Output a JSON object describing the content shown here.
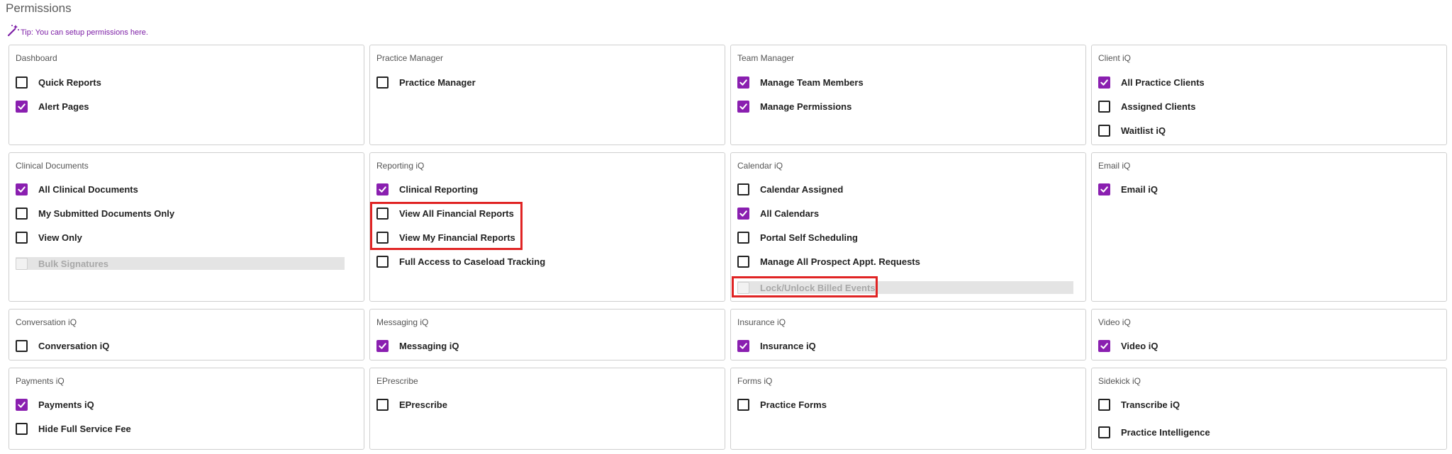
{
  "page": {
    "title": "Permissions",
    "tip": "Tip: You can setup permissions here."
  },
  "colors": {
    "accent": "#8a1fb0",
    "highlight": "#e02424",
    "disabled_bg": "#e4e4e4"
  },
  "cards": {
    "dashboard": {
      "title": "Dashboard",
      "items": [
        {
          "label": "Quick Reports",
          "checked": false
        },
        {
          "label": "Alert Pages",
          "checked": true
        }
      ]
    },
    "practice_manager": {
      "title": "Practice Manager",
      "items": [
        {
          "label": "Practice Manager",
          "checked": false
        }
      ]
    },
    "team_manager": {
      "title": "Team Manager",
      "items": [
        {
          "label": "Manage Team Members",
          "checked": true
        },
        {
          "label": "Manage Permissions",
          "checked": true
        }
      ]
    },
    "client_iq": {
      "title": "Client iQ",
      "items": [
        {
          "label": "All Practice Clients",
          "checked": true
        },
        {
          "label": "Assigned Clients",
          "checked": false
        },
        {
          "label": "Waitlist iQ",
          "checked": false
        }
      ]
    },
    "clinical_documents": {
      "title": "Clinical Documents",
      "items": [
        {
          "label": "All Clinical Documents",
          "checked": true
        },
        {
          "label": "My Submitted Documents Only",
          "checked": false
        },
        {
          "label": "View Only",
          "checked": false
        },
        {
          "label": "Bulk Signatures",
          "checked": false,
          "disabled": true
        }
      ]
    },
    "reporting_iq": {
      "title": "Reporting iQ",
      "items": [
        {
          "label": "Clinical Reporting",
          "checked": true
        },
        {
          "label": "View All Financial Reports",
          "checked": false
        },
        {
          "label": "View My Financial Reports",
          "checked": false
        },
        {
          "label": "Full Access to Caseload Tracking",
          "checked": false
        }
      ]
    },
    "calendar_iq": {
      "title": "Calendar iQ",
      "items": [
        {
          "label": "Calendar Assigned",
          "checked": false
        },
        {
          "label": "All Calendars",
          "checked": true
        },
        {
          "label": "Portal Self Scheduling",
          "checked": false
        },
        {
          "label": "Manage All Prospect Appt. Requests",
          "checked": false
        },
        {
          "label": "Lock/Unlock Billed Events",
          "checked": false,
          "disabled": true
        }
      ]
    },
    "email_iq": {
      "title": "Email iQ",
      "items": [
        {
          "label": "Email iQ",
          "checked": true
        }
      ]
    },
    "conversation_iq": {
      "title": "Conversation iQ",
      "items": [
        {
          "label": "Conversation iQ",
          "checked": false
        }
      ]
    },
    "messaging_iq": {
      "title": "Messaging iQ",
      "items": [
        {
          "label": "Messaging iQ",
          "checked": true
        }
      ]
    },
    "insurance_iq": {
      "title": "Insurance iQ",
      "items": [
        {
          "label": "Insurance iQ",
          "checked": true
        }
      ]
    },
    "video_iq": {
      "title": "Video iQ",
      "items": [
        {
          "label": "Video iQ",
          "checked": true
        }
      ]
    },
    "payments_iq": {
      "title": "Payments iQ",
      "items": [
        {
          "label": "Payments iQ",
          "checked": true
        },
        {
          "label": "Hide Full Service Fee",
          "checked": false
        }
      ]
    },
    "eprescribe": {
      "title": "EPrescribe",
      "items": [
        {
          "label": "EPrescribe",
          "checked": false
        }
      ]
    },
    "forms_iq": {
      "title": "Forms iQ",
      "items": [
        {
          "label": "Practice Forms",
          "checked": false
        }
      ]
    },
    "sidekick_iq": {
      "title": "Sidekick iQ",
      "items": [
        {
          "label": "Transcribe iQ",
          "checked": false
        },
        {
          "label": "Practice Intelligence",
          "checked": false
        }
      ]
    }
  }
}
